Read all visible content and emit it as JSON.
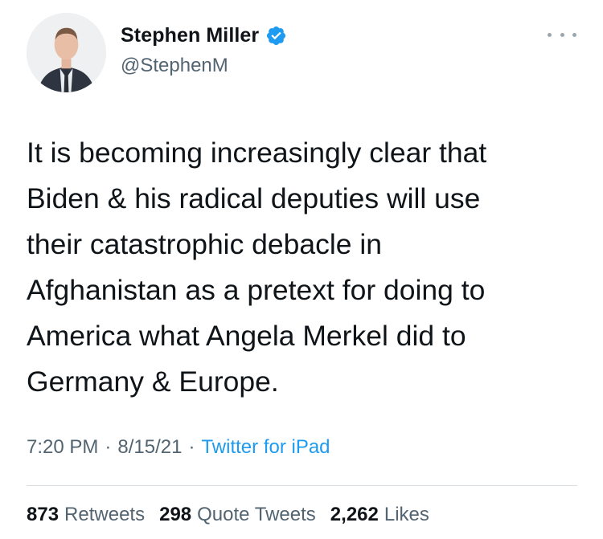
{
  "author": {
    "display_name": "Stephen Miller",
    "handle": "@StephenM",
    "verified": true
  },
  "tweet": {
    "text": "It is becoming increasingly clear that\nBiden & his radical deputies will use\ntheir catastrophic debacle in\nAfghanistan as a pretext for doing to\nAmerica what Angela Merkel did to\nGermany & Europe.",
    "time": "7:20 PM",
    "separator": "·",
    "date": "8/15/21",
    "source": "Twitter for iPad"
  },
  "stats": {
    "retweets": {
      "count": "873",
      "label": "Retweets"
    },
    "quote_tweets": {
      "count": "298",
      "label": "Quote Tweets"
    },
    "likes": {
      "count": "2,262",
      "label": "Likes"
    }
  },
  "icons": {
    "verified": "verified-badge-icon",
    "more": "more-options-icon"
  },
  "colors": {
    "accent": "#1d9bf0",
    "text": "#0f1419",
    "secondary": "#536471",
    "divider": "#d9dee2"
  }
}
